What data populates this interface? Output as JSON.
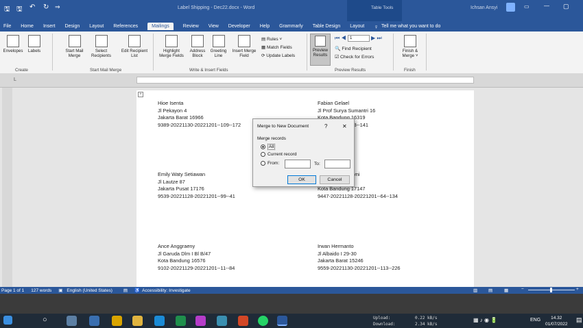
{
  "window": {
    "title": "Label Shipping - Dec22.docx  -  Word",
    "table_tools": "Table Tools",
    "user": "Ichsan Ansyi"
  },
  "menu": [
    "File",
    "Home",
    "Insert",
    "Design",
    "Layout",
    "References",
    "Mailings",
    "Review",
    "View",
    "Developer",
    "Help",
    "Grammarly",
    "Table Design",
    "Layout"
  ],
  "tell_me": "Tell me what you want to do",
  "ribbon": {
    "create": {
      "envelopes": "Envelopes",
      "labels": "Labels",
      "group": "Create"
    },
    "start": {
      "start_mail_merge": "Start Mail Merge",
      "select_recipients": "Select Recipients",
      "edit_list": "Edit Recipient List",
      "group": "Start Mail Merge"
    },
    "write": {
      "highlight": "Highlight Merge Fields",
      "address": "Address Block",
      "greeting": "Greeting Line",
      "insert_field": "Insert Merge Field",
      "rules": "Rules",
      "match": "Match Fields",
      "update": "Update Labels",
      "group": "Write & Insert Fields"
    },
    "preview": {
      "preview": "Preview Results",
      "record": "1",
      "find": "Find Recipient",
      "check": "Check for Errors",
      "group": "Preview Results"
    },
    "finish": {
      "finish": "Finish & Merge",
      "group": "Finish"
    }
  },
  "ruler_text": "L",
  "labels": [
    {
      "name": "Hioe Isenta",
      "street": "Jl Pekayon 4",
      "city": "Jakarta Barat 16966",
      "code": "9389-20221130-20221201--109--172"
    },
    {
      "name": "Fabian Gelael",
      "street": "Jl Prof Surya Sumantri 16",
      "city": "Kota Bandung 16319",
      "code": "8-20221201--108--141"
    },
    {
      "name": "Emily Waty Setiawan",
      "street": "Jl Lautze 87",
      "city": "Jakarta Pusat 17176",
      "code": "9539-20221128-20221201--99--41"
    },
    {
      "name": "vni",
      "street": "",
      "city": "Kota Bandung 17147",
      "code": "9447-20221128-20221201--64--134"
    },
    {
      "name": "Ance Anggraeny",
      "street": "Jl Garuda Dlm I Bl B/47",
      "city": "Kota Bandung 16576",
      "code": "9102-20221129-20221201--11--84"
    },
    {
      "name": "Irwan Hermanto",
      "street": "Jl Albaido I 29-30",
      "city": "Jakarta Barat 15246",
      "code": "9559-20221130-20221201--113--226"
    }
  ],
  "dialog": {
    "title": "Merge to New Document",
    "help": "?",
    "close": "✕",
    "group": "Merge records",
    "all": "All",
    "current": "Current record",
    "from": "From:",
    "to": "To:",
    "ok": "OK",
    "cancel": "Cancel"
  },
  "status": {
    "page": "Page 1 of 1",
    "words": "127 words",
    "language": "English (United States)",
    "accessibility": "Accessibility: Investigate"
  },
  "taskbar": {
    "upload_label": "Upload:",
    "upload_val": "0.22 kB/s",
    "download_label": "Download:",
    "download_val": "2.34 kB/s",
    "lang": "ENG",
    "time": "14.32",
    "date": "01/07/2022"
  }
}
